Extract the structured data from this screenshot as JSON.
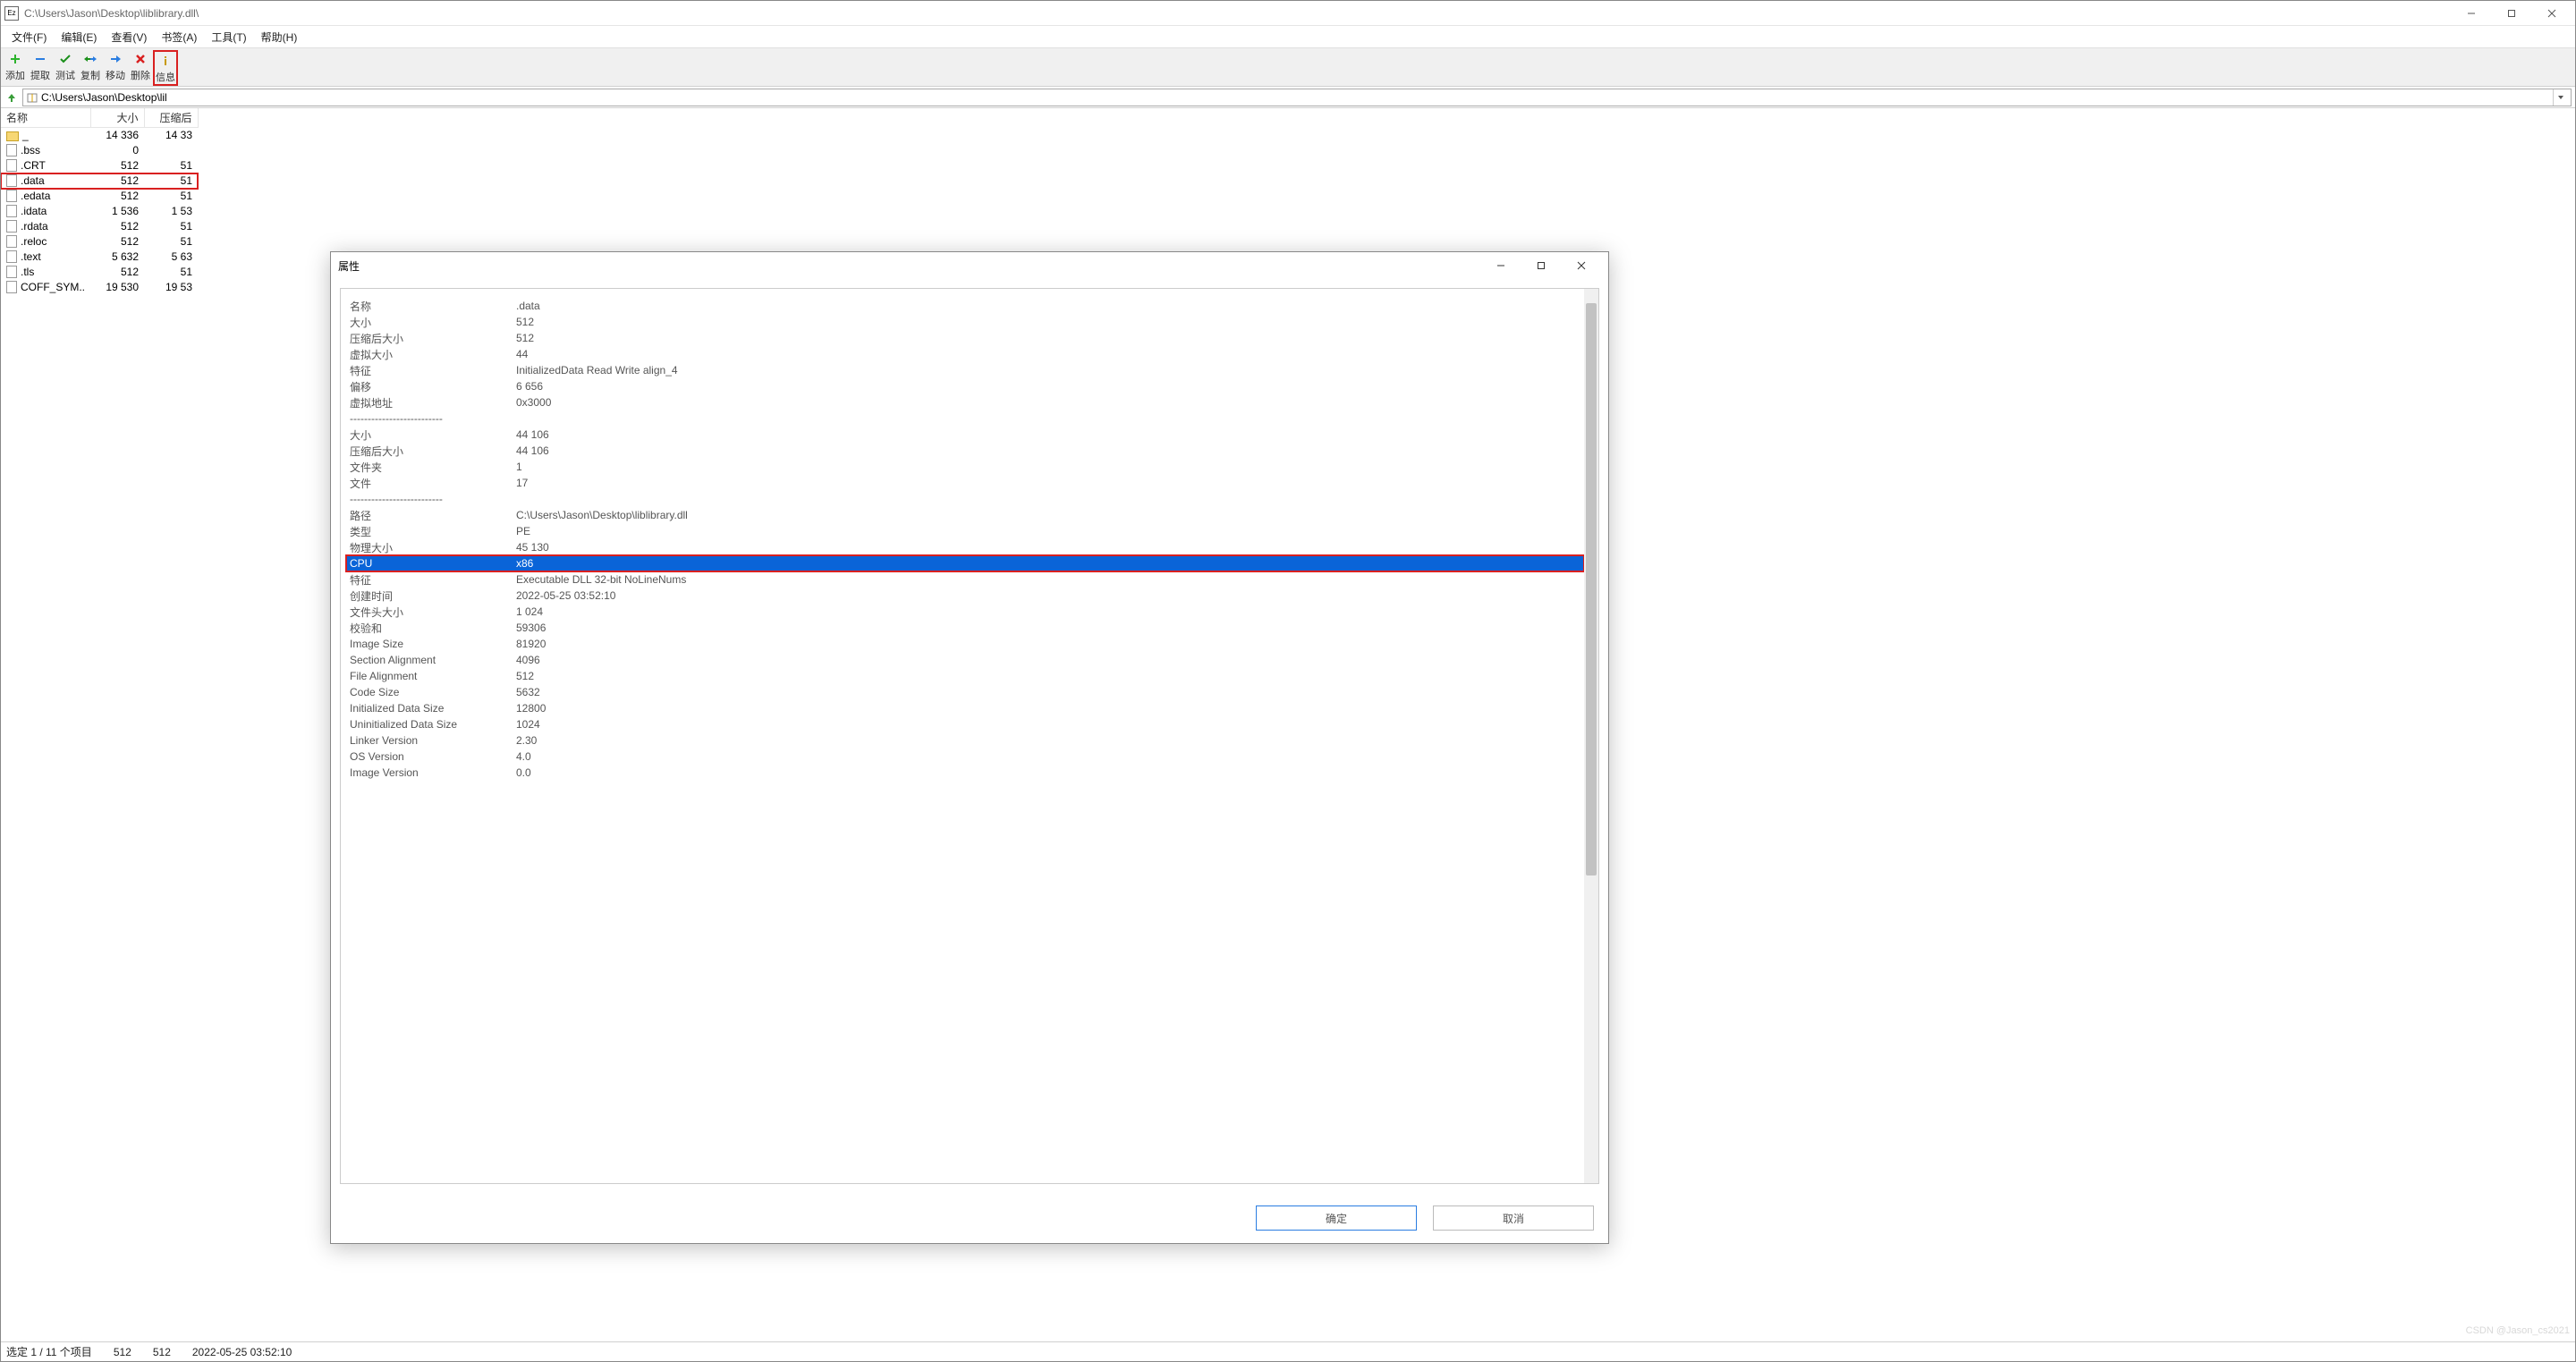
{
  "window": {
    "app_icon_text": "Ez",
    "title": "C:\\Users\\Jason\\Desktop\\liblibrary.dll\\"
  },
  "menubar": [
    {
      "label": "文件(F)"
    },
    {
      "label": "编辑(E)"
    },
    {
      "label": "查看(V)"
    },
    {
      "label": "书签(A)"
    },
    {
      "label": "工具(T)"
    },
    {
      "label": "帮助(H)"
    }
  ],
  "toolbar": [
    {
      "icon": "plus",
      "color": "#2db32d",
      "label": "添加"
    },
    {
      "icon": "minus",
      "color": "#2a7de1",
      "label": "提取"
    },
    {
      "icon": "check",
      "color": "#1a8f1a",
      "label": "测试"
    },
    {
      "icon": "arrow-left-right",
      "color": "#2a7de1",
      "label": "复制"
    },
    {
      "icon": "arrow-right",
      "color": "#2a7de1",
      "label": "移动"
    },
    {
      "icon": "x",
      "color": "#d92020",
      "label": "删除"
    },
    {
      "icon": "info",
      "color": "#c79a00",
      "label": "信息",
      "highlight": true
    }
  ],
  "pathbar": {
    "path": "C:\\Users\\Jason\\Desktop\\lil"
  },
  "file_list": {
    "columns": [
      "名称",
      "大小",
      "压缩后"
    ],
    "rows": [
      {
        "type": "folder",
        "name": "_",
        "size": "14 336",
        "packed": "14 33"
      },
      {
        "type": "file",
        "name": ".bss",
        "size": "0",
        "packed": ""
      },
      {
        "type": "file",
        "name": ".CRT",
        "size": "512",
        "packed": "51"
      },
      {
        "type": "file",
        "name": ".data",
        "size": "512",
        "packed": "51",
        "highlight": true
      },
      {
        "type": "file",
        "name": ".edata",
        "size": "512",
        "packed": "51"
      },
      {
        "type": "file",
        "name": ".idata",
        "size": "1 536",
        "packed": "1 53"
      },
      {
        "type": "file",
        "name": ".rdata",
        "size": "512",
        "packed": "51"
      },
      {
        "type": "file",
        "name": ".reloc",
        "size": "512",
        "packed": "51"
      },
      {
        "type": "file",
        "name": ".text",
        "size": "5 632",
        "packed": "5 63"
      },
      {
        "type": "file",
        "name": ".tls",
        "size": "512",
        "packed": "51"
      },
      {
        "type": "file",
        "name": "COFF_SYM..",
        "size": "19 530",
        "packed": "19 53"
      }
    ]
  },
  "statusbar": {
    "selection": "选定 1 / 11 个项目",
    "size": "512",
    "packed": "512",
    "date": "2022-05-25 03:52:10"
  },
  "dialog": {
    "title": "属性",
    "ok": "确定",
    "cancel": "取消",
    "rows": [
      {
        "k": "名称",
        "v": ".data"
      },
      {
        "k": "大小",
        "v": "512"
      },
      {
        "k": "压缩后大小",
        "v": "512"
      },
      {
        "k": "虚拟大小",
        "v": "44"
      },
      {
        "k": "特征",
        "v": "InitializedData Read Write align_4"
      },
      {
        "k": "偏移",
        "v": "6 656"
      },
      {
        "k": "虚拟地址",
        "v": "0x3000"
      },
      {
        "sep": "--------------------------"
      },
      {
        "k": "大小",
        "v": "44 106"
      },
      {
        "k": "压缩后大小",
        "v": "44 106"
      },
      {
        "k": "文件夹",
        "v": "1"
      },
      {
        "k": "文件",
        "v": "17"
      },
      {
        "sep": "--------------------------"
      },
      {
        "k": "路径",
        "v": "C:\\Users\\Jason\\Desktop\\liblibrary.dll"
      },
      {
        "k": "类型",
        "v": "PE"
      },
      {
        "k": "物理大小",
        "v": "45 130"
      },
      {
        "k": "CPU",
        "v": "x86",
        "selected": true
      },
      {
        "k": "特征",
        "v": "Executable DLL 32-bit NoLineNums"
      },
      {
        "k": "创建时间",
        "v": "2022-05-25 03:52:10"
      },
      {
        "k": "文件头大小",
        "v": "1 024"
      },
      {
        "k": "校验和",
        "v": "59306"
      },
      {
        "k": "Image Size",
        "v": "81920"
      },
      {
        "k": "Section Alignment",
        "v": "4096"
      },
      {
        "k": "File Alignment",
        "v": "512"
      },
      {
        "k": "Code Size",
        "v": "5632"
      },
      {
        "k": "Initialized Data Size",
        "v": "12800"
      },
      {
        "k": "Uninitialized Data Size",
        "v": "1024"
      },
      {
        "k": "Linker Version",
        "v": "2.30"
      },
      {
        "k": "OS Version",
        "v": "4.0"
      },
      {
        "k": "Image Version",
        "v": "0.0"
      }
    ]
  },
  "watermark": "CSDN @Jason_cs2021"
}
